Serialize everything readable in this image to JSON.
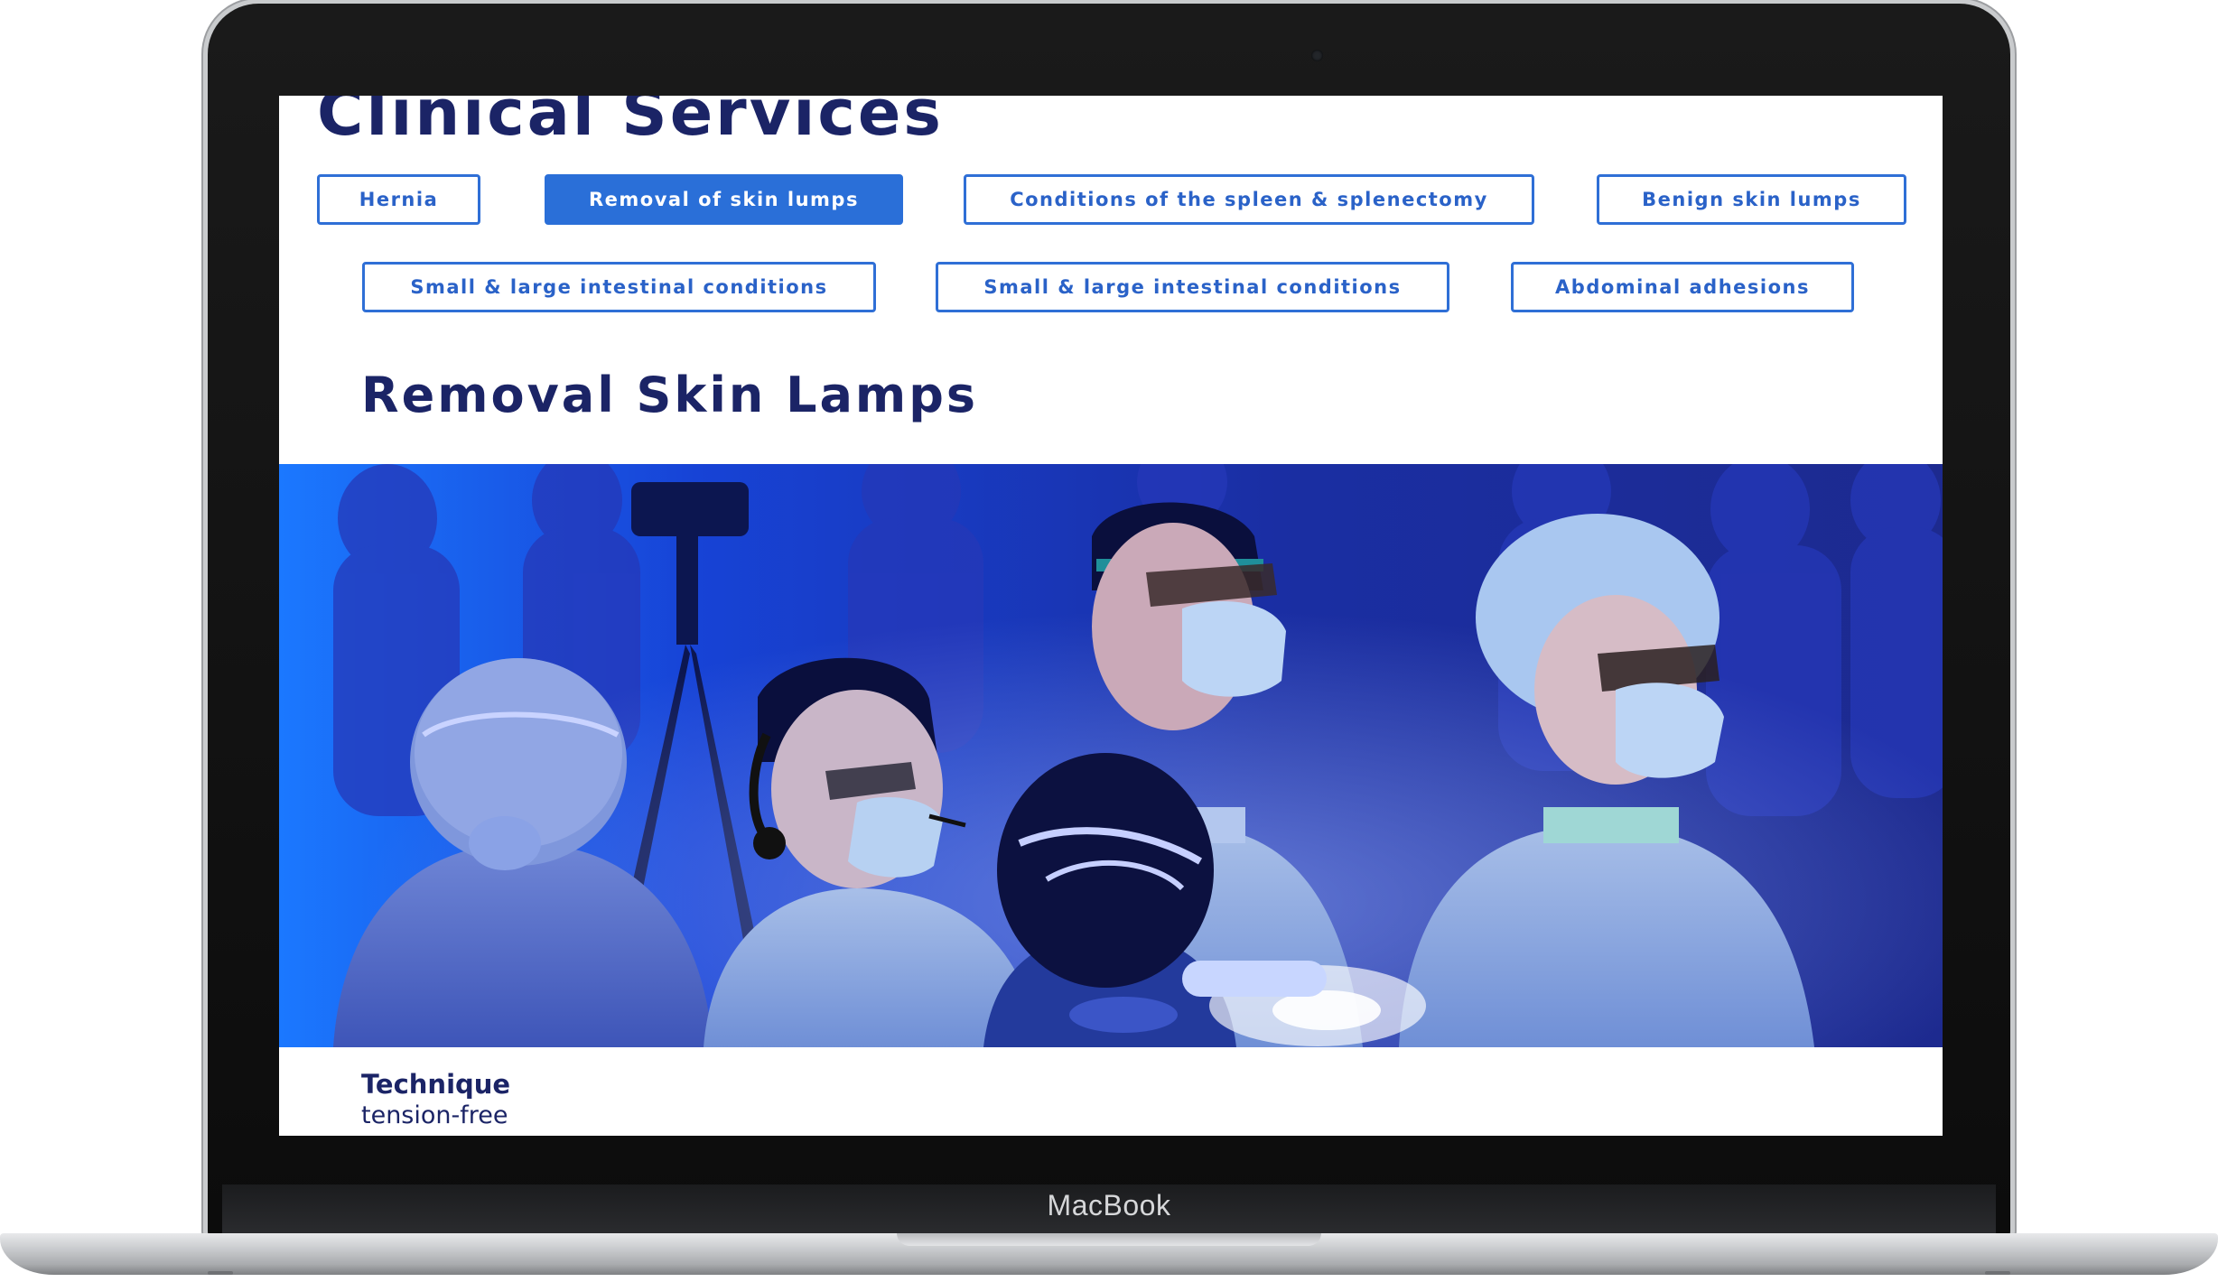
{
  "device": {
    "brand_label": "MacBook"
  },
  "page": {
    "section_title": "Clinical Services",
    "service_tabs": [
      {
        "label": "Hernia",
        "active": false
      },
      {
        "label": "Removal of skin lumps",
        "active": true
      },
      {
        "label": "Conditions of the spleen & splenectomy",
        "active": false
      },
      {
        "label": "Benign skin lumps",
        "active": false
      },
      {
        "label": "Small & large intestinal conditions",
        "active": false
      },
      {
        "label": "Small & large intestinal conditions",
        "active": false
      },
      {
        "label": "Abdominal adhesions",
        "active": false
      }
    ],
    "content_title": "Removal Skin Lamps",
    "hero_image": "surgical-team-photo",
    "technique": {
      "label": "Technique",
      "value": "tension-free"
    }
  },
  "colors": {
    "accent": "#2a6fd8",
    "heading": "#1b2466",
    "tab_border": "#2f6fd6",
    "hero_blue": "#1439c9"
  }
}
